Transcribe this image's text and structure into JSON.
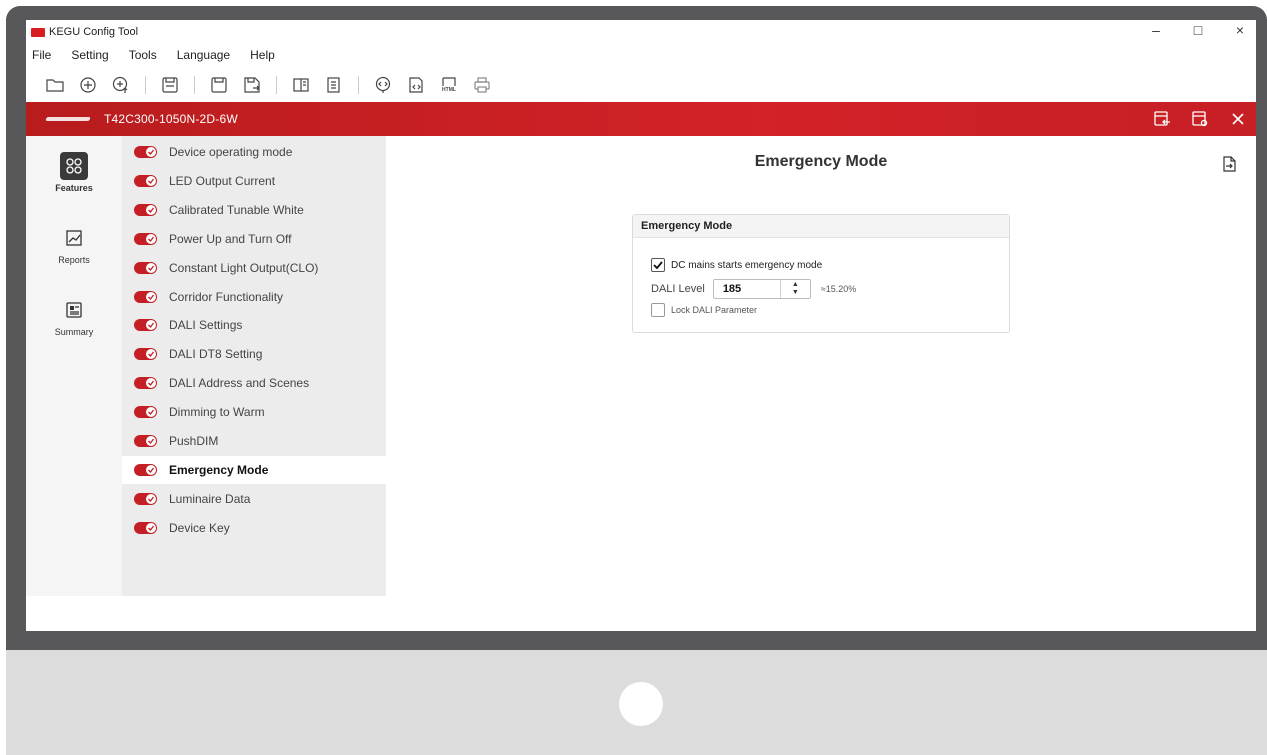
{
  "app": {
    "title": "KEGU Config Tool"
  },
  "window_controls": {
    "minimize": "–",
    "maximize": "□",
    "close": "×"
  },
  "menu": [
    "File",
    "Setting",
    "Tools",
    "Language",
    "Help"
  ],
  "toolbar_icons": [
    "open-folder-icon",
    "add-circle-icon",
    "add-upload-icon",
    "save-icon",
    "save-as-icon",
    "save-export-icon",
    "compare-icon",
    "document-icon",
    "read-device-icon",
    "code-icon",
    "html-icon",
    "print-icon"
  ],
  "device": {
    "name": "T42C300-1050N-2D-6W"
  },
  "rail": [
    {
      "label": "Features",
      "icon": "features-icon"
    },
    {
      "label": "Reports",
      "icon": "reports-icon"
    },
    {
      "label": "Summary",
      "icon": "summary-icon"
    }
  ],
  "features": [
    {
      "label": "Device operating mode",
      "enabled": true
    },
    {
      "label": "LED Output Current",
      "enabled": true
    },
    {
      "label": "Calibrated Tunable White",
      "enabled": true
    },
    {
      "label": "Power Up and Turn Off",
      "enabled": true
    },
    {
      "label": "Constant Light Output(CLO)",
      "enabled": true
    },
    {
      "label": "Corridor Functionality",
      "enabled": true
    },
    {
      "label": "DALI Settings",
      "enabled": true
    },
    {
      "label": "DALI DT8 Setting",
      "enabled": true
    },
    {
      "label": "DALI Address and Scenes",
      "enabled": true
    },
    {
      "label": "Dimming to Warm",
      "enabled": true
    },
    {
      "label": "PushDIM",
      "enabled": true
    },
    {
      "label": "Emergency Mode",
      "enabled": true,
      "selected": true
    },
    {
      "label": "Luminaire Data",
      "enabled": true
    },
    {
      "label": "Device Key",
      "enabled": true
    }
  ],
  "main": {
    "title": "Emergency Mode",
    "panel": {
      "title": "Emergency Mode",
      "dc_mains_label": "DC mains starts emergency mode",
      "dc_mains_checked": true,
      "dali_level_label": "DALI Level",
      "dali_level_value": "185",
      "dali_level_percent": "≈15.20%",
      "lock_label": "Lock DALI Parameter",
      "lock_checked": false
    }
  },
  "colors": {
    "accent": "#c41f25",
    "header_red": "#d32228"
  }
}
